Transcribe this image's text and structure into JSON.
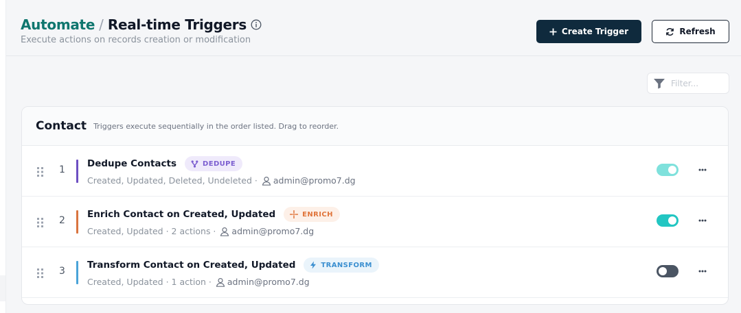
{
  "header": {
    "breadcrumb_parent": "Automate",
    "breadcrumb_separator": "/",
    "title": "Real-time Triggers",
    "subtitle": "Execute actions on records creation or modification",
    "create_label": "Create Trigger",
    "refresh_label": "Refresh"
  },
  "filter": {
    "placeholder": "Filter..."
  },
  "section": {
    "title": "Contact",
    "hint": "Triggers execute sequentially in the order listed. Drag to reorder."
  },
  "triggers": [
    {
      "index": "1",
      "name": "Dedupe Contacts",
      "badge": "DEDUPE",
      "badge_icon": "merge-icon",
      "events": "Created, Updated, Deleted, Undeleted ·",
      "user": "admin@promo7.dg",
      "enabled": true,
      "accent": "#6d4fc2",
      "badge_bg": "#efeafb",
      "badge_fg": "#7c5fd0",
      "toggle_color": "#7fe1dc"
    },
    {
      "index": "2",
      "name": "Enrich Contact on Created, Updated",
      "badge": "ENRICH",
      "badge_icon": "sparkle-icon",
      "events": "Created, Updated · 2 actions ·",
      "user": "admin@promo7.dg",
      "enabled": true,
      "accent": "#d9743f",
      "badge_bg": "#fdf0e8",
      "badge_fg": "#e0743a",
      "toggle_color": "#22c6c2"
    },
    {
      "index": "3",
      "name": "Transform Contact on Created, Updated",
      "badge": "TRANSFORM",
      "badge_icon": "bolt-icon",
      "events": "Created, Updated · 1 action ·",
      "user": "admin@promo7.dg",
      "enabled": false,
      "accent": "#4aa3d8",
      "badge_bg": "#eaf4fb",
      "badge_fg": "#3b8fd0",
      "toggle_color": "#4b5563"
    }
  ]
}
